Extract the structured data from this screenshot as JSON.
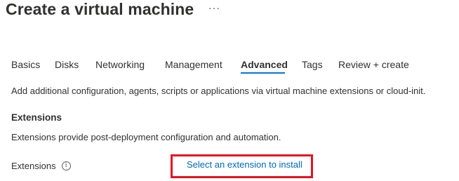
{
  "header": {
    "title": "Create a virtual machine",
    "more_label": "···"
  },
  "tabs": [
    {
      "label": "Basics",
      "active": false
    },
    {
      "label": "Disks",
      "active": false
    },
    {
      "label": "Networking",
      "active": false
    },
    {
      "label": "Management",
      "active": false
    },
    {
      "label": "Advanced",
      "active": true
    },
    {
      "label": "Tags",
      "active": false
    },
    {
      "label": "Review + create",
      "active": false
    }
  ],
  "main": {
    "description": "Add additional configuration, agents, scripts or applications via virtual machine extensions or cloud-init.",
    "extensions": {
      "heading": "Extensions",
      "description": "Extensions provide post-deployment configuration and automation.",
      "field_label": "Extensions",
      "info_icon": "i",
      "link_text": "Select an extension to install"
    }
  },
  "colors": {
    "accent": "#0078d4",
    "link": "#0067b8",
    "highlight": "#e81123"
  }
}
